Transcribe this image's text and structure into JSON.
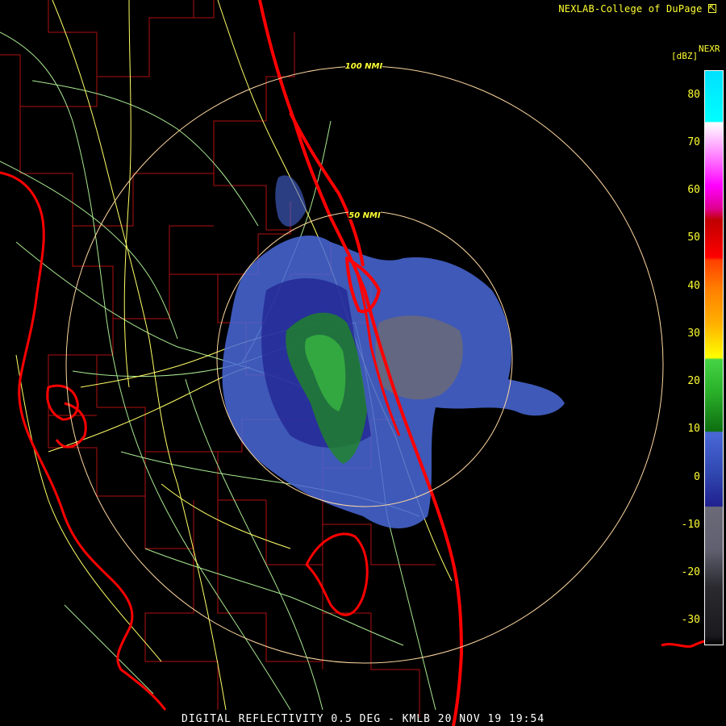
{
  "credit": "NEXLAB-College of DuPage",
  "credit_icon": "cursor-arrow-icon",
  "product_code": "NEXR",
  "legend": {
    "unit": "[dBZ]",
    "ticks": [
      "80",
      "70",
      "60",
      "50",
      "40",
      "30",
      "20",
      "10",
      "0",
      "-10",
      "-20",
      "-30"
    ],
    "range_dbz": [
      -35,
      85
    ],
    "colors": [
      "#000000",
      "#2a2a2f",
      "#6a6a78",
      "#20208f",
      "#4a68d8",
      "#0e6e10",
      "#44d444",
      "#ffff00",
      "#ff7f00",
      "#ff0000",
      "#ff00ff",
      "#ffffff",
      "#00ffff"
    ]
  },
  "range_rings": {
    "inner_label": "50 NMI",
    "outer_label": "100 NMI"
  },
  "map_colors": {
    "coastline": "#ff0000",
    "county_lines": "#b01010",
    "highways": "#ffff66",
    "roads": "#a8e890",
    "range_rings": "#ffd8a0"
  },
  "footer": "DIGITAL REFLECTIVITY 0.5 DEG - KMLB 20 NOV 19 19:54"
}
